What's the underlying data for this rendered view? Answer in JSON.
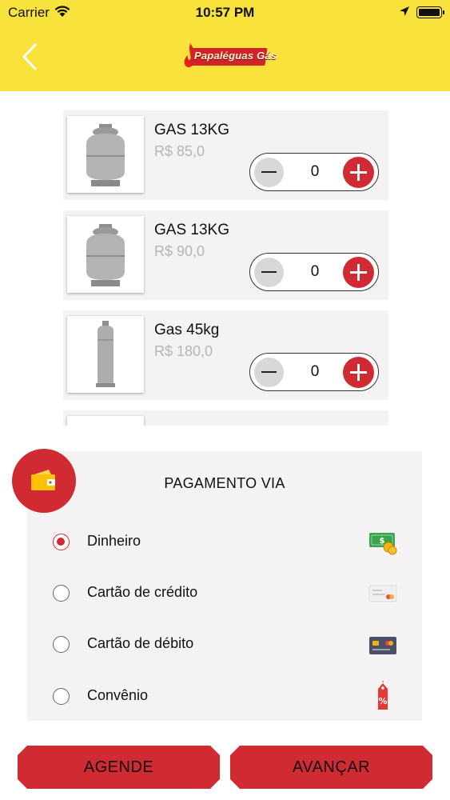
{
  "status_bar": {
    "carrier": "Carrier",
    "time": "10:57 PM"
  },
  "header": {
    "logo_text": "Papaléguas Gás",
    "colors": {
      "background": "#f8e23b",
      "brand_red": "#d1232a"
    }
  },
  "products": [
    {
      "name": "GAS 13KG",
      "price": "R$ 85,0",
      "quantity": "0"
    },
    {
      "name": "GAS 13KG",
      "price": "R$ 90,0",
      "quantity": "0"
    },
    {
      "name": "Gas 45kg",
      "price": "R$ 180,0",
      "quantity": "0"
    }
  ],
  "payment": {
    "title": "PAGAMENTO VIA",
    "options": [
      {
        "label": "Dinheiro",
        "selected": true,
        "icon": "cash-icon"
      },
      {
        "label": "Cartão de crédito",
        "selected": false,
        "icon": "credit-card-icon"
      },
      {
        "label": "Cartão de débito",
        "selected": false,
        "icon": "debit-card-icon"
      },
      {
        "label": "Convênio",
        "selected": false,
        "icon": "discount-tag-icon"
      }
    ]
  },
  "buttons": {
    "schedule": "AGENDE",
    "next": "AVANÇAR"
  }
}
